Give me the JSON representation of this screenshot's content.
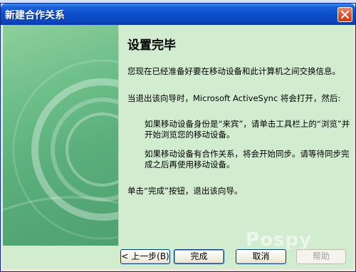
{
  "window": {
    "title": "新建合作关系"
  },
  "content": {
    "heading": "设置完毕",
    "para1": "您现在已经准备好要在移动设备和此计算机之间交换信息。",
    "para2": "当退出该向导时，Microsoft ActiveSync 将会打开，然后:",
    "para3": "如果移动设备身份是“来宾”，请单击工具栏上的“浏览”并开始浏览您的移动设备。",
    "para4": "如果移动设备有合作关系，将会开始同步。请等待同步完成之后再使用移动设备。",
    "para5": "单击“完成”按钮，退出该向导。"
  },
  "buttons": {
    "back": "< 上一步(B)",
    "finish": "完成",
    "cancel": "取消",
    "help": "帮助"
  },
  "watermark": "Pospy"
}
